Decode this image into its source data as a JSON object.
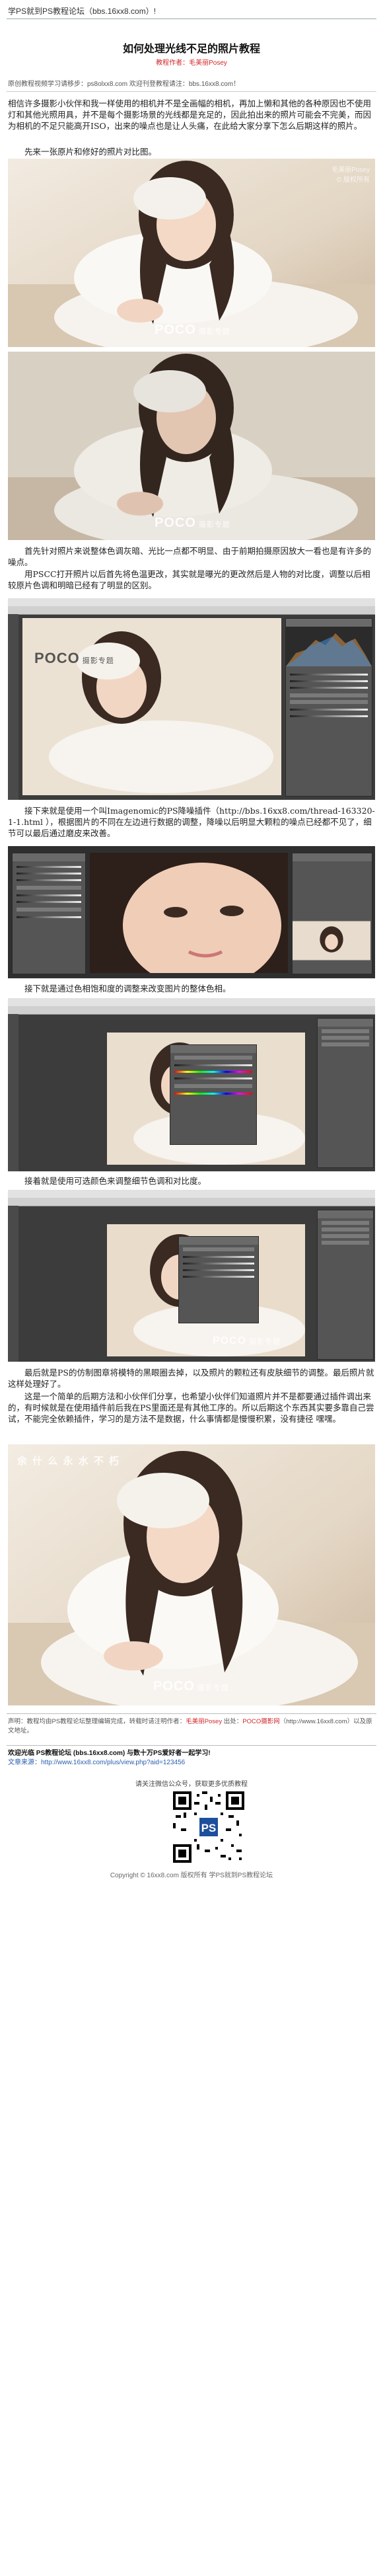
{
  "header": {
    "site_name": "学PS就到PS教程论坛（bbs.16xx8.com）!"
  },
  "article": {
    "title": "如何处理光线不足的照片教程",
    "author": "教程作者：毛美丽Posey",
    "source_line": "原创教程视频学习请移步：ps8olxx8.com 欢迎刊登教程请注：bbs.16xx8.com！",
    "paragraphs": [
      "相信许多摄影小伙伴和我一样使用的相机并不是全画幅的相机，再加上懒和其他的各种原因也不使用灯和其他光照用具，并不是每个摄影场景的光线都是充足的，因此拍出来的照片可能会不完美，而因为相机的不足只能高开ISO，出来的噪点也是让人头痛，在此给大家分享下怎么后期这样的照片。",
      "先来一张原片和修好的照片对比图。",
      "首先针对照片来说整体色调灰暗、光比一点都不明显、由于前期拍摄原因放大一看也是有许多的噪点。",
      "用PSCC打开照片以后首先将色温更改，其实就是曝光的更改然后是人物的对比度，调整以后相较原片色调和明暗已经有了明显的区别。",
      "接下来就是使用一个叫Imagenomic的PS降噪插件（http://bbs.16xx8.com/thread-163320-1-1.html ），根据图片的不同在左边进行数据的调整，降噪以后明显大颗粒的噪点已经都不见了，细节可以最后通过磨皮来改善。",
      "接下就是通过色相饱和度的调整来改变图片的整体色相。",
      "接着就是使用可选颜色来调整细节色调和对比度。",
      "最后就是PS的仿制图章将模特的黑眼圈去掉，以及照片的颗粒还有皮肤细节的调整。最后照片就这样处理好了。",
      "这是一个简单的后期方法和小伙伴们分享，也希望小伙伴们知道照片并不是都要通过插件调出来的，有时候就是在使用插件前后我在PS里面还是有其他工序的。所以后期这个东西其实要多靠自己尝试，不能完全依赖插件，学习的是方法不是数据，什么事情都是慢慢积累，没有捷径   嘿嘿。"
    ]
  },
  "watermarks": {
    "poco": "POCO",
    "poco_sub": "摄影专题",
    "stamp_1": "毛美丽Posey",
    "stamp_2": "© 版权所有",
    "chinese_wm": "余 什 么 永 水 不 朽"
  },
  "footer": {
    "credit_prefix": "声明：教程均由PS教程论坛整理编辑完成，转载时请注明作者：",
    "credit_author": "毛美丽Posey",
    "credit_mid": "出处：",
    "credit_source": "POCO摄影网",
    "credit_tail": "（http://www.16xx8.com）以及原文地址。",
    "bottom_line1": "欢迎光临 PS教程论坛 (bbs.16xx8.com) 与数十万PS爱好者一起学习!",
    "bottom_line2": "文章来源：http://www.16xx8.com/plus/view.php?aid=123456",
    "qr_caption": "请关注微信公众号，获取更多优质教程",
    "qr_badge": "PS",
    "copyright": "Copyright © 16xx8.com 版权所有 学PS就到PS教程论坛"
  },
  "colors": {
    "accent_red": "#d2262a",
    "link_blue": "#2a5db0",
    "photo_warm": "#e9dccb",
    "ps_dark": "#3c3c3c"
  }
}
